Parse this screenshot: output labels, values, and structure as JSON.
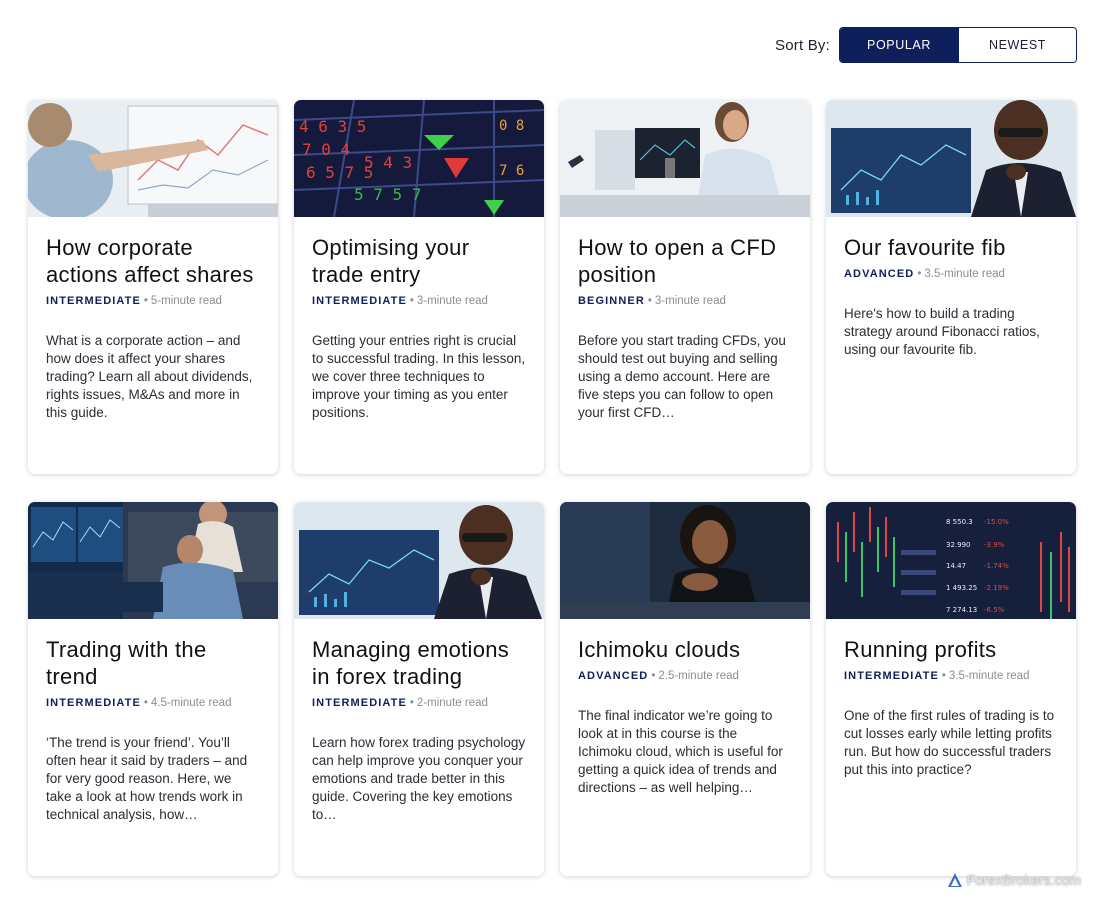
{
  "sort": {
    "label": "Sort By:",
    "options": [
      "POPULAR",
      "NEWEST"
    ],
    "selected": "POPULAR"
  },
  "cards": [
    {
      "title": "How corporate actions affect shares",
      "level": "INTERMEDIATE",
      "read_time": "5-minute read",
      "description": "What is a corporate action – and how does it affect your shares trading? Learn all about dividends, rights issues, M&As and more in this guide.",
      "image": "woman-touching-chart-screen"
    },
    {
      "title": "Optimising your trade entry",
      "level": "INTERMEDIATE",
      "read_time": "3-minute read",
      "description": "Getting your entries right is crucial to successful trading. In this lesson, we cover three techniques to improve your timing as you enter positions.",
      "image": "stock-ticker-board"
    },
    {
      "title": "How to open a CFD position",
      "level": "BEGINNER",
      "read_time": "3-minute read",
      "description": "Before you start trading CFDs, you should test out buying and selling using a demo account. Here are five steps you can follow to open your first CFD…",
      "image": "man-at-desk-monitors"
    },
    {
      "title": "Our favourite fib",
      "level": "ADVANCED",
      "read_time": "3.5-minute read",
      "description": "Here's how to build a trading strategy around Fibonacci ratios, using our favourite fib.",
      "image": "man-with-glasses-thinking"
    },
    {
      "title": "Trading with the trend",
      "level": "INTERMEDIATE",
      "read_time": "4.5-minute read",
      "description": "‘The trend is your friend’. You’ll often hear it said by traders – and for very good reason. Here, we take a look at how trends work in technical analysis, how…",
      "image": "traders-multi-screens"
    },
    {
      "title": "Managing emotions in forex trading",
      "level": "INTERMEDIATE",
      "read_time": "2-minute read",
      "description": "Learn how forex trading psychology can help improve you conquer your emotions and trade better in this guide. Covering the key emotions to…",
      "image": "man-with-glasses-thinking-2"
    },
    {
      "title": "Ichimoku clouds",
      "level": "ADVANCED",
      "read_time": "2.5-minute read",
      "description": "The final indicator we’re going to look at in this course is the Ichimoku cloud, which is useful for getting a quick idea of trends and directions – as well helping…",
      "image": "woman-at-night-desk"
    },
    {
      "title": "Running profits",
      "level": "INTERMEDIATE",
      "read_time": "3.5-minute read",
      "description": "One of the first rules of trading is to cut losses early while letting profits run. But how do successful traders put this into practice?",
      "image": "candlestick-price-board"
    }
  ],
  "watermark": "ForexBrokers.com",
  "colors": {
    "navy": "#0f1f5c",
    "meta_gray": "#8a8d96"
  }
}
